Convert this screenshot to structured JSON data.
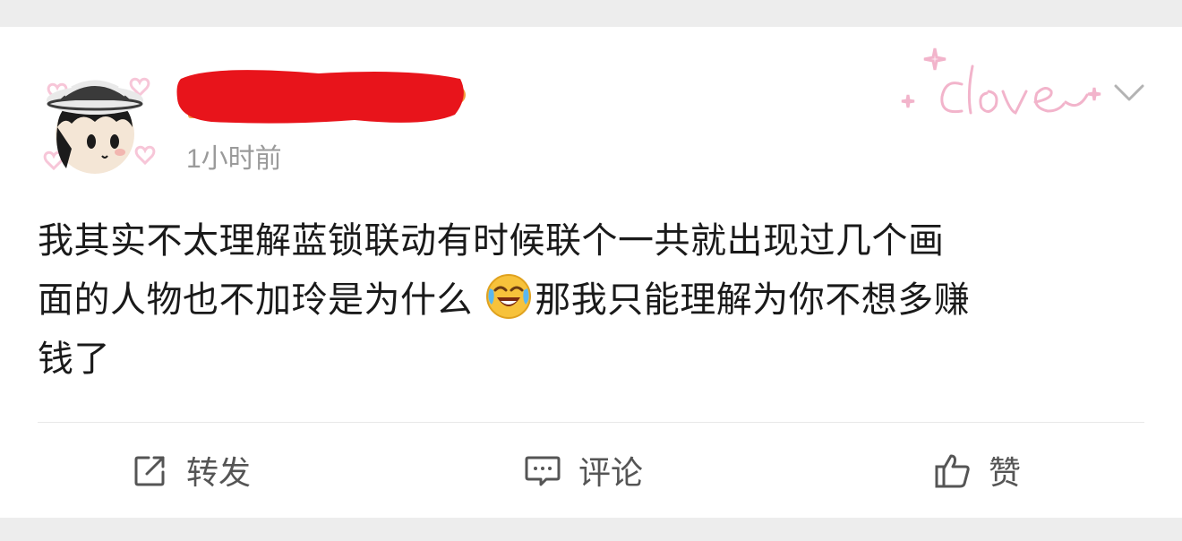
{
  "post": {
    "timestamp": "1小时前",
    "text_lines": [
      "我其实不太理解蓝锁联动有时候联个一共就出现过几个画",
      "面的人物也不加玲是为什么",
      "那我只能理解为你不想多赚",
      "钱了"
    ],
    "emoji": "laughing-crying-emoji",
    "decoration_text": "clove"
  },
  "actions": {
    "repost_label": "转发",
    "comment_label": "评论",
    "like_label": "赞"
  },
  "colors": {
    "redaction": "#e8141b",
    "timestamp": "#9a9a9a",
    "text": "#1a1a1a",
    "action_text": "#555555",
    "decoration_pink": "#f4b8cf"
  }
}
